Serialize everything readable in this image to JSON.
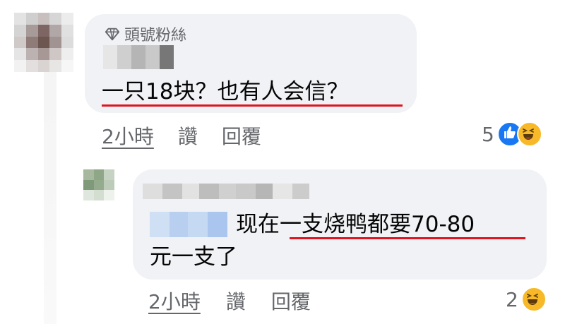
{
  "comment1": {
    "badge_label": "頭號粉絲",
    "text_part1": "一只18块？也有人会信？",
    "time": "2小時",
    "like_label": "讚",
    "reply_label": "回覆",
    "reaction_count": "5",
    "reaction_icons": [
      "like-icon",
      "haha-icon"
    ]
  },
  "comment2": {
    "text_line1": "现在一支烧鸭都要70-80",
    "text_line2": "元一支了",
    "time": "2小時",
    "like_label": "讚",
    "reply_label": "回覆",
    "reaction_count": "2",
    "reaction_icons": [
      "haha-icon"
    ]
  },
  "colors": {
    "bubble": "#f0f2f5",
    "text": "#050505",
    "muted": "#65676b",
    "underline": "#e0141e",
    "like": "#1877f2",
    "haha": "#f7b928"
  }
}
